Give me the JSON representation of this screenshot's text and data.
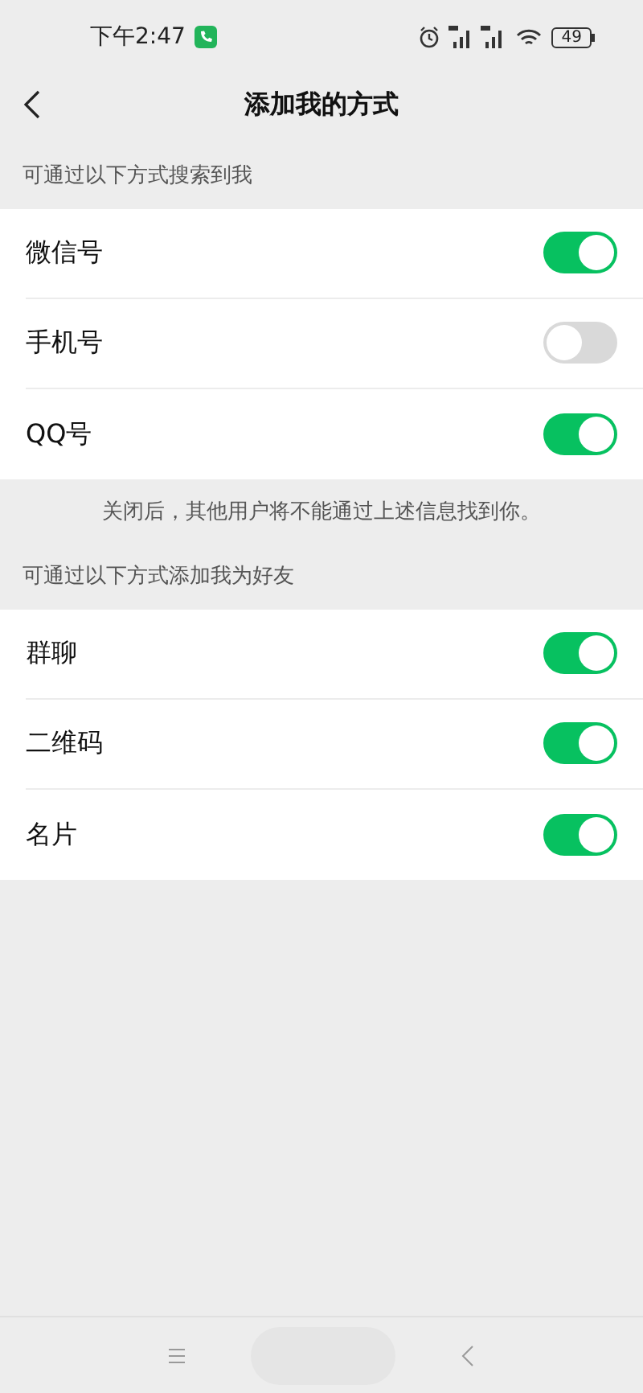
{
  "status_bar": {
    "time": "下午2:47",
    "battery": "49"
  },
  "header": {
    "title": "添加我的方式"
  },
  "sections": [
    {
      "label": "可通过以下方式搜索到我",
      "items": [
        {
          "label": "微信号",
          "on": true
        },
        {
          "label": "手机号",
          "on": false
        },
        {
          "label": "QQ号",
          "on": true
        }
      ],
      "note": "关闭后，其他用户将不能通过上述信息找到你。"
    },
    {
      "label": "可通过以下方式添加我为好友",
      "items": [
        {
          "label": "群聊",
          "on": true
        },
        {
          "label": "二维码",
          "on": true
        },
        {
          "label": "名片",
          "on": true
        }
      ]
    }
  ]
}
